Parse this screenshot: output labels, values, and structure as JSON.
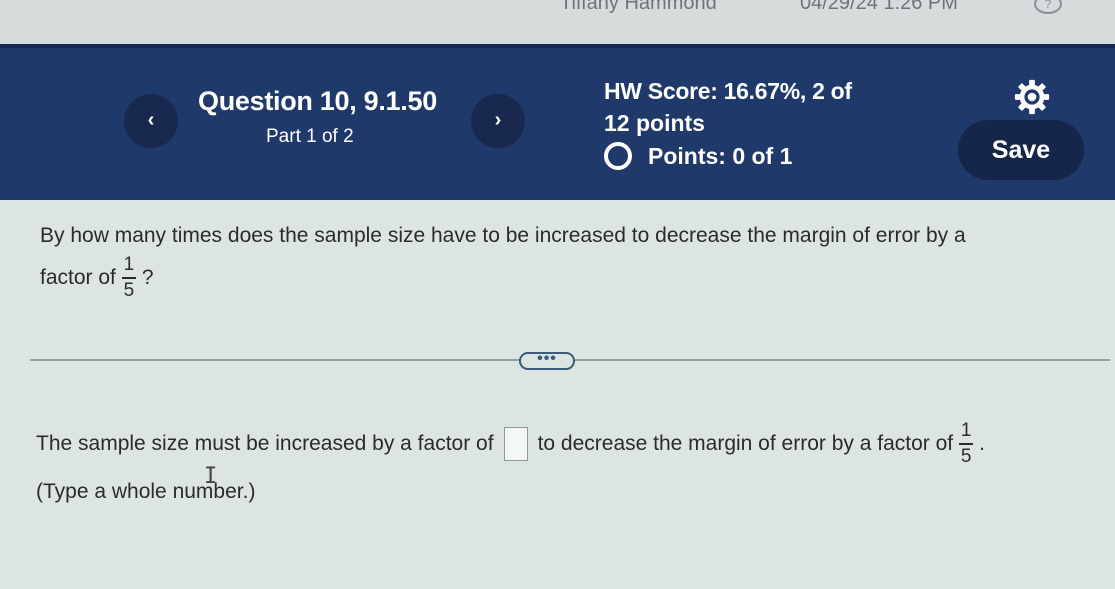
{
  "top_bar": {
    "user_name": "Tiffany Hammond",
    "timestamp": "04/29/24 1:26 PM",
    "help_icon": "help-icon"
  },
  "header": {
    "question_title": "Question 10, 9.1.50",
    "part_label": "Part 1 of 2",
    "hw_score_line1": "HW Score: 16.67%, 2 of",
    "hw_score_line2": "12 points",
    "points_label": "Points: 0 of 1",
    "save_label": "Save",
    "prev_icon": "‹",
    "next_icon": "›",
    "colors": {
      "header_bg": "#1f3a6a",
      "button_bg": "#16264a"
    }
  },
  "question": {
    "text_line1": "By how many times does the sample size have to be increased to decrease the margin of error by a",
    "text_line2_prefix": "factor of",
    "fraction_numerator": "1",
    "fraction_denominator": "5",
    "text_line2_suffix": "?"
  },
  "more_button": {
    "label": "•••"
  },
  "answer": {
    "prefix": "The sample size must be increased by a factor of",
    "suffix": "to decrease the margin of error by a factor of",
    "fraction_numerator": "1",
    "fraction_denominator": "5",
    "end": ".",
    "input_value": "",
    "hint": "(Type a whole number.)"
  }
}
